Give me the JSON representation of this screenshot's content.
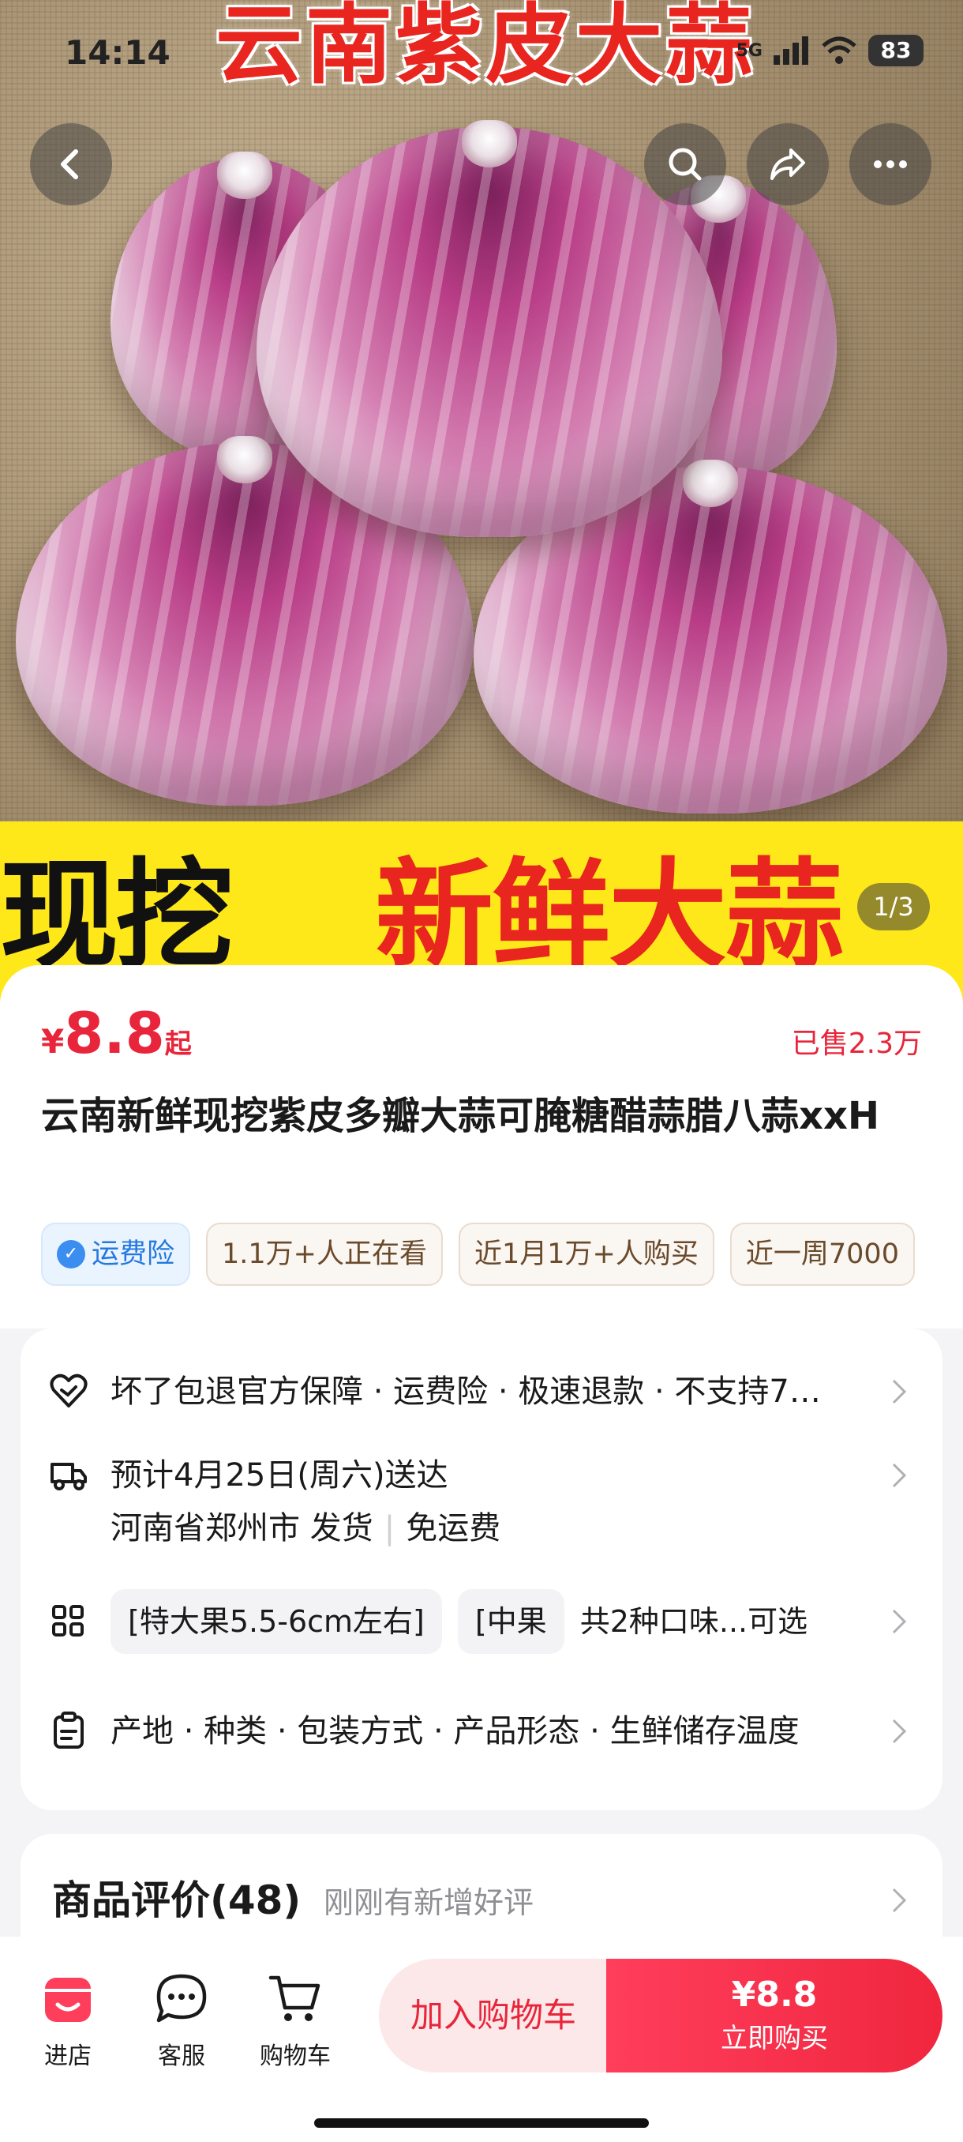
{
  "status_bar": {
    "time": "14:14",
    "network": "5G",
    "battery": "83"
  },
  "gallery": {
    "banner_top": "云南紫皮大蒜",
    "banner_bottom_left": "现挖",
    "banner_bottom_right": "新鲜大蒜",
    "page_indicator": "1/3"
  },
  "product": {
    "currency": "¥",
    "price": "8.8",
    "price_suffix": "起",
    "sold": "已售2.3万",
    "title": "云南新鲜现挖紫皮多瓣大蒜可腌糖醋蒜腊八蒜xxH",
    "tags": {
      "shipping_insurance": "运费险",
      "viewing": "1.1万+人正在看",
      "bought_month": "近1月1万+人购买",
      "bought_week": "近一周7000"
    }
  },
  "services": {
    "guarantee": "坏了包退官方保障 · 运费险 · 极速退款 · 不支持7…",
    "delivery": "预计4月25日(周六)送达",
    "ship_from": "河南省郑州市 发货",
    "shipping_fee": "免运费",
    "spec_option_1": "[特大果5.5-6cm左右]",
    "spec_option_2": "[中果",
    "spec_summary": "共2种口味...可选",
    "params": "产地 · 种类 · 包装方式 · 产品形态 · 生鲜储存温度"
  },
  "reviews": {
    "title": "商品评价(48)",
    "subtitle": "刚刚有新增好评"
  },
  "bottom_bar": {
    "store": "进店",
    "service": "客服",
    "cart": "购物车",
    "add_to_cart": "加入购物车",
    "buy_price": "¥8.8",
    "buy_now": "立即购买"
  },
  "colors": {
    "accent": "#e8253a",
    "banner_yellow": "#ffe81a",
    "banner_red": "#e8251e"
  }
}
